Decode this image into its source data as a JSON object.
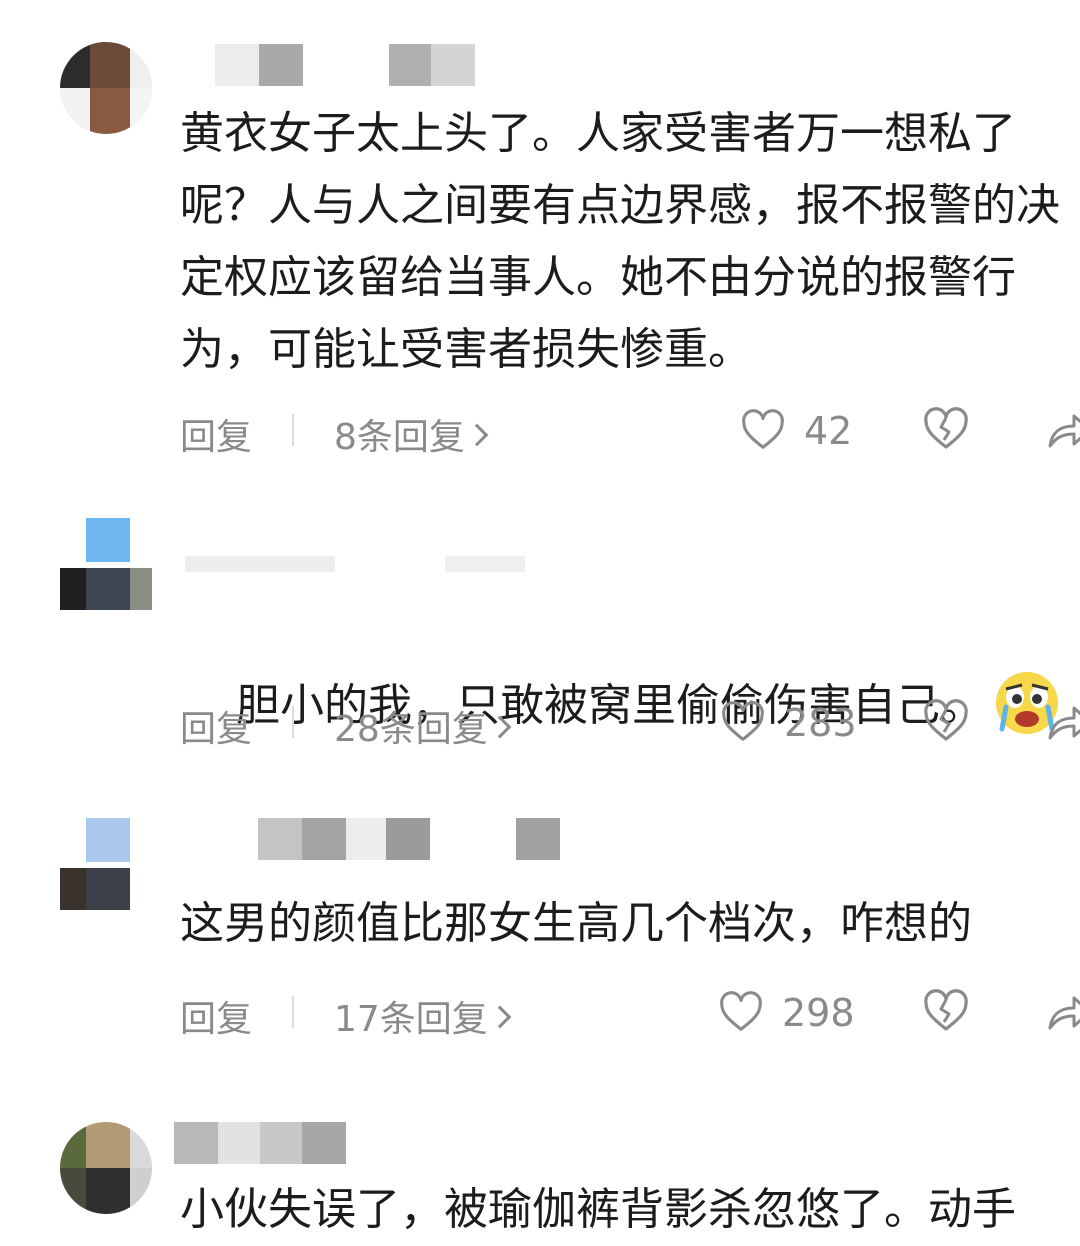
{
  "comments": [
    {
      "text": "黄衣女子太上头了。人家受害者万一想私了呢？人与人之间要有点边界感，报不报警的决定权应该留给当事人。她不由分说的报警行为，可能让受害者损失惨重。",
      "reply_label": "回复",
      "replies_label": "8条回复",
      "likes": "42",
      "icons": {
        "like": "heart-outline-icon",
        "dislike": "broken-heart-icon",
        "share": "share-icon"
      }
    },
    {
      "text": "胆小的我，只敢被窝里偷偷伤害自己。",
      "emoji": "crying-emoji-icon",
      "reply_label": "回复",
      "replies_label": "28条回复",
      "likes": "283",
      "icons": {
        "like": "heart-outline-icon",
        "dislike": "broken-heart-icon",
        "share": "share-icon"
      }
    },
    {
      "text": "这男的颜值比那女生高几个档次，咋想的",
      "reply_label": "回复",
      "replies_label": "17条回复",
      "likes": "298",
      "icons": {
        "like": "heart-outline-icon",
        "dislike": "broken-heart-icon",
        "share": "share-icon"
      }
    },
    {
      "text": "小伙失误了，被瑜伽裤背影杀忽悠了。动手"
    }
  ],
  "colors": {
    "text": "#1c1c1c",
    "meta": "#8a8a8a",
    "background": "#ffffff",
    "emoji": "#f6d84a"
  }
}
